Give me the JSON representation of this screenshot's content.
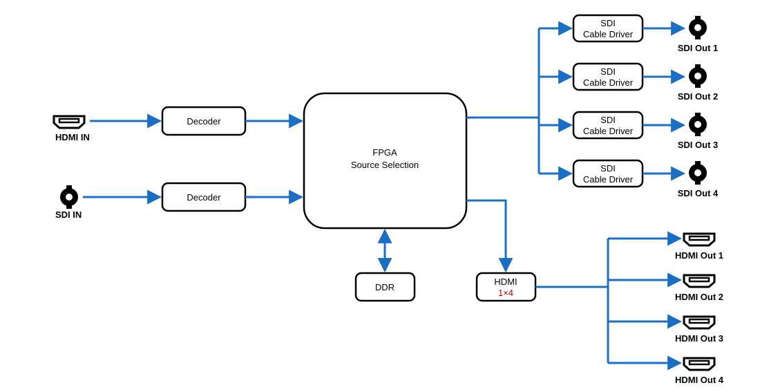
{
  "inputs": {
    "hdmi_in_label": "HDMI IN",
    "sdi_in_label": "SDI IN"
  },
  "decoder_top_label": "Decoder",
  "decoder_bottom_label": "Decoder",
  "fpga": {
    "line1": "FPGA",
    "line2": "Source Selection"
  },
  "ddr_label": "DDR",
  "sdi_driver_line1": "SDI",
  "sdi_driver_line2": "Cable Driver",
  "sdi_outputs": [
    "SDI Out 1",
    "SDI Out 2",
    "SDI Out 3",
    "SDI Out 4"
  ],
  "hdmi_split": {
    "line1": "HDMI",
    "line2": "1×4"
  },
  "hdmi_outputs": [
    "HDMI Out 1",
    "HDMI Out 2",
    "HDMI Out 3",
    "HDMI Out 4"
  ]
}
